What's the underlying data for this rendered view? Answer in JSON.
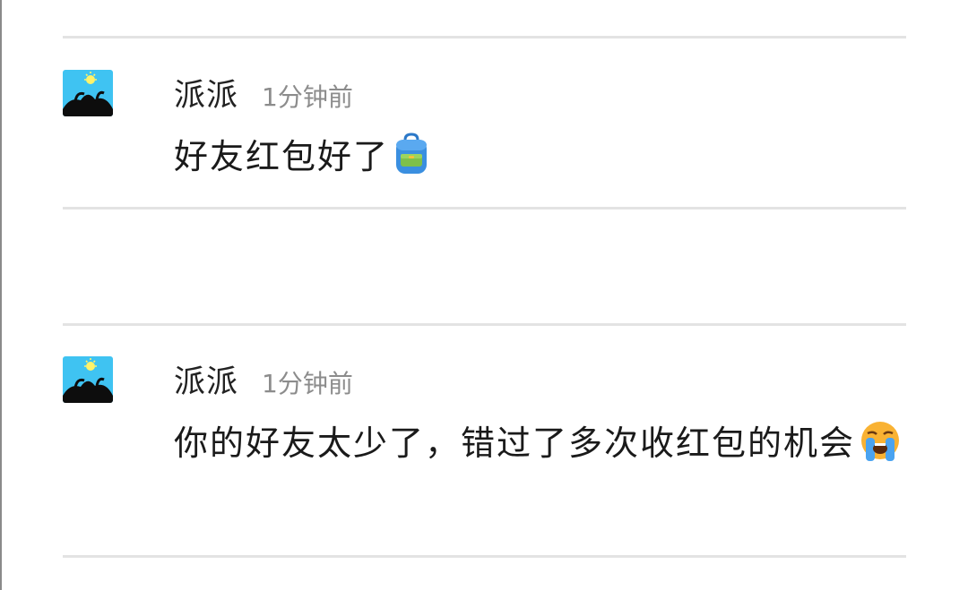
{
  "comments": [
    {
      "username": "派派",
      "time": "1分钟前",
      "text": "好友红包好了",
      "emoji": "backpack-icon",
      "avatar": "sun-silhouette-avatar"
    },
    {
      "username": "派派",
      "time": "1分钟前",
      "text": "你的好友太少了，错过了多次收红包的机会",
      "emoji": "loudly-crying-face-icon",
      "avatar": "sun-silhouette-avatar"
    }
  ],
  "colors": {
    "avatar_bg": "#3fc3f2",
    "divider": "#e3e3e3",
    "username": "#222222",
    "time": "#8c8c8c",
    "text": "#1a1a1a"
  }
}
